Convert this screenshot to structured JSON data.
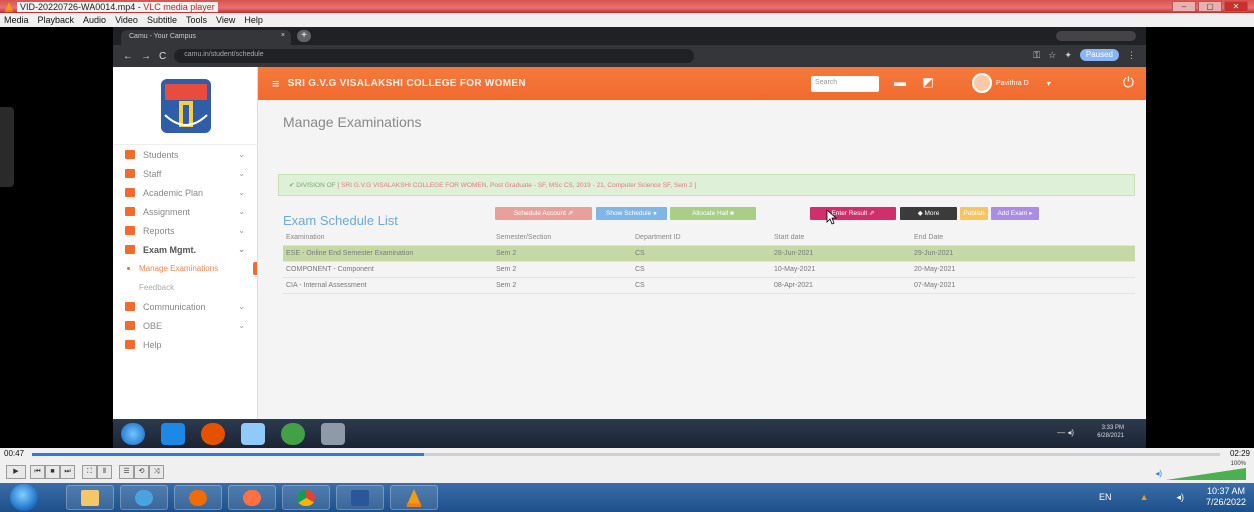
{
  "vlc": {
    "title_file": "VID-20220726-WA0014.mp4",
    "title_sep": " - ",
    "title_app": "VLC media player",
    "menu": [
      "Media",
      "Playback",
      "Audio",
      "Video",
      "Subtitle",
      "Tools",
      "View",
      "Help"
    ],
    "time_elapsed": "00:47",
    "time_total": "02:29",
    "progress_fraction": 0.33,
    "volume_percent": "100%",
    "controls": [
      "▶",
      "⏮",
      "■",
      "⏭",
      "⛶",
      "⦀",
      "☰",
      "⟲",
      "⤨"
    ]
  },
  "browser": {
    "tab_title": "Camu - Your Campus",
    "tab_close": "×",
    "new_tab": "+",
    "url": "camu.in/student/schedule",
    "paused_label": "Paused"
  },
  "app": {
    "college_name": "SRI G.V.G VISALAKSHI COLLEGE FOR WOMEN",
    "search_placeholder": "Search",
    "user_name": "Pavithra D",
    "sidebar": [
      {
        "label": "Students",
        "color": "#f26a2e"
      },
      {
        "label": "Staff",
        "color": "#f26a2e"
      },
      {
        "label": "Academic Plan",
        "color": "#f26a2e"
      },
      {
        "label": "Assignment",
        "color": "#f26a2e"
      },
      {
        "label": "Reports",
        "color": "#f26a2e"
      },
      {
        "label": "Exam Mgmt.",
        "color": "#f26a2e"
      },
      {
        "label": "Manage Examinations"
      },
      {
        "label": "Feedback"
      },
      {
        "label": "Communication",
        "color": "#f26a2e"
      },
      {
        "label": "OBE",
        "color": "#f26a2e"
      },
      {
        "label": "Help",
        "color": "#f26a2e"
      }
    ],
    "page_title": "Manage Examinations",
    "alert_prefix": "DIVISION OF",
    "alert_text": "[ SRI G.V.G VISALAKSHI COLLEGE FOR WOMEN, Post Graduate - SF, MSc CS, 2019 - 21, Computer Science SF, Sem 2 ]",
    "list_title": "Exam Schedule List",
    "buttons": [
      {
        "label": "Schedule Account",
        "color": "#e8a09a"
      },
      {
        "label": "Show Schedule",
        "color": "#7fb6e6"
      },
      {
        "label": "Allocate Hall",
        "color": "#a9cf86"
      },
      {
        "label": "Enter Result",
        "color": "#cf2f6b"
      },
      {
        "label": "More",
        "color": "#3b3b3b"
      },
      {
        "label": "Publish",
        "color": "#f6c562"
      },
      {
        "label": "Add Exam",
        "color": "#a98de3"
      }
    ],
    "table_headers": [
      "Examination",
      "Semester/Section",
      "Department ID",
      "Start date",
      "End Date"
    ],
    "table_rows": [
      [
        "ESE - Online End Semester Examination",
        "Sem 2",
        "CS",
        "28-Jun-2021",
        "29-Jun-2021"
      ],
      [
        "COMPONENT - Component",
        "Sem 2",
        "CS",
        "10-May-2021",
        "20-May-2021"
      ],
      [
        "CIA - Internal Assessment",
        "Sem 2",
        "CS",
        "08-Apr-2021",
        "07-May-2021"
      ]
    ]
  },
  "recorded_taskbar": {
    "clock_time": "3:33 PM",
    "clock_date": "6/28/2021"
  },
  "taskbar": {
    "lang": "EN",
    "time": "10:37 AM",
    "date": "7/26/2022"
  }
}
